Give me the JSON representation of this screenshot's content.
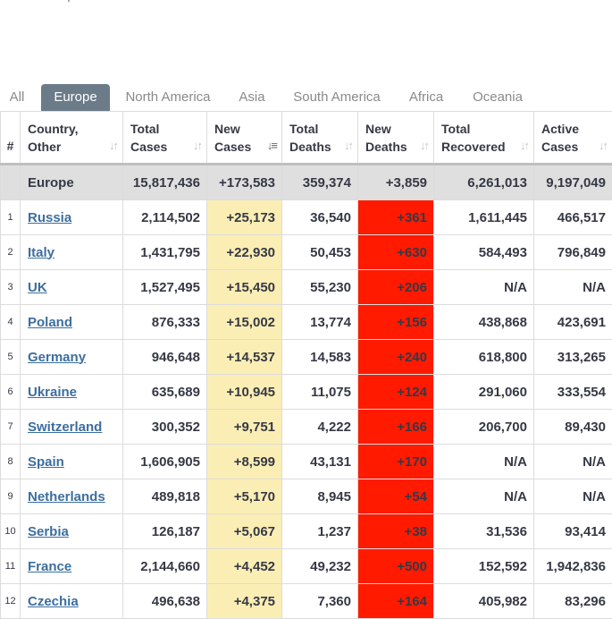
{
  "tabs": [
    "All",
    "Europe",
    "North America",
    "Asia",
    "South America",
    "Africa",
    "Oceania"
  ],
  "active_tab": "Europe",
  "columns": {
    "num": "#",
    "country": [
      "Country,",
      "Other"
    ],
    "total_cases": [
      "Total",
      "Cases"
    ],
    "new_cases": [
      "New",
      "Cases"
    ],
    "total_deaths": [
      "Total",
      "Deaths"
    ],
    "new_deaths": [
      "New",
      "Deaths"
    ],
    "total_recovered": [
      "Total",
      "Recovered"
    ],
    "active_cases": [
      "Active",
      "Cases"
    ]
  },
  "region": {
    "name": "Europe",
    "total_cases": "15,817,436",
    "new_cases": "+173,583",
    "total_deaths": "359,374",
    "new_deaths": "+3,859",
    "total_recovered": "6,261,013",
    "active_cases": "9,197,049"
  },
  "rows": [
    {
      "num": "1",
      "country": "Russia",
      "total_cases": "2,114,502",
      "new_cases": "+25,173",
      "total_deaths": "36,540",
      "new_deaths": "+361",
      "total_recovered": "1,611,445",
      "active_cases": "466,517"
    },
    {
      "num": "2",
      "country": "Italy",
      "total_cases": "1,431,795",
      "new_cases": "+22,930",
      "total_deaths": "50,453",
      "new_deaths": "+630",
      "total_recovered": "584,493",
      "active_cases": "796,849"
    },
    {
      "num": "3",
      "country": "UK",
      "total_cases": "1,527,495",
      "new_cases": "+15,450",
      "total_deaths": "55,230",
      "new_deaths": "+206",
      "total_recovered": "N/A",
      "active_cases": "N/A"
    },
    {
      "num": "4",
      "country": "Poland",
      "total_cases": "876,333",
      "new_cases": "+15,002",
      "total_deaths": "13,774",
      "new_deaths": "+156",
      "total_recovered": "438,868",
      "active_cases": "423,691"
    },
    {
      "num": "5",
      "country": "Germany",
      "total_cases": "946,648",
      "new_cases": "+14,537",
      "total_deaths": "14,583",
      "new_deaths": "+240",
      "total_recovered": "618,800",
      "active_cases": "313,265"
    },
    {
      "num": "6",
      "country": "Ukraine",
      "total_cases": "635,689",
      "new_cases": "+10,945",
      "total_deaths": "11,075",
      "new_deaths": "+124",
      "total_recovered": "291,060",
      "active_cases": "333,554"
    },
    {
      "num": "7",
      "country": "Switzerland",
      "total_cases": "300,352",
      "new_cases": "+9,751",
      "total_deaths": "4,222",
      "new_deaths": "+166",
      "total_recovered": "206,700",
      "active_cases": "89,430"
    },
    {
      "num": "8",
      "country": "Spain",
      "total_cases": "1,606,905",
      "new_cases": "+8,599",
      "total_deaths": "43,131",
      "new_deaths": "+170",
      "total_recovered": "N/A",
      "active_cases": "N/A"
    },
    {
      "num": "9",
      "country": "Netherlands",
      "total_cases": "489,818",
      "new_cases": "+5,170",
      "total_deaths": "8,945",
      "new_deaths": "+54",
      "total_recovered": "N/A",
      "active_cases": "N/A"
    },
    {
      "num": "10",
      "country": "Serbia",
      "total_cases": "126,187",
      "new_cases": "+5,067",
      "total_deaths": "1,237",
      "new_deaths": "+38",
      "total_recovered": "31,536",
      "active_cases": "93,414"
    },
    {
      "num": "11",
      "country": "France",
      "total_cases": "2,144,660",
      "new_cases": "+4,452",
      "total_deaths": "49,232",
      "new_deaths": "+500",
      "total_recovered": "152,592",
      "active_cases": "1,942,836"
    },
    {
      "num": "12",
      "country": "Czechia",
      "total_cases": "496,638",
      "new_cases": "+4,375",
      "total_deaths": "7,360",
      "new_deaths": "+164",
      "total_recovered": "405,982",
      "active_cases": "83,296"
    }
  ],
  "sort_icons": {
    "default": "sort-icon",
    "active": "sort-desc-icon"
  },
  "colors": {
    "new_cases_bg": "#fbeeb5",
    "new_deaths_bg": "#ff1a00",
    "active_tab_bg": "#6b7b88",
    "link": "#3c6e9e"
  }
}
